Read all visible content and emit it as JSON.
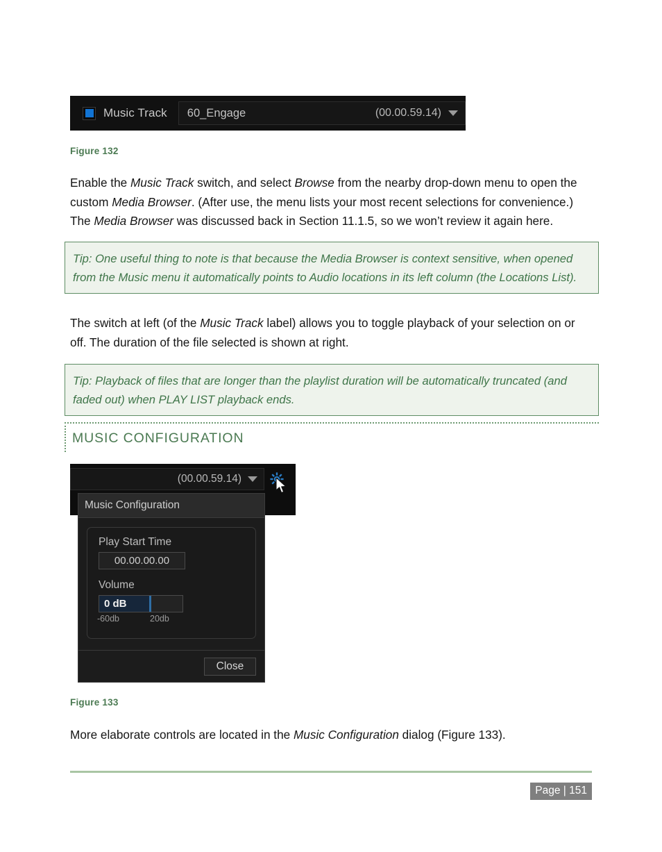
{
  "figure132": {
    "checkbox_state": "checked",
    "accent_color": "#1274d4",
    "label": "Music Track",
    "file_name": "60_Engage",
    "duration": "(00.00.59.14)",
    "dropdown_icon": "chevron-down-icon",
    "caption": "Figure 132"
  },
  "paragraphs": {
    "p1": {
      "seg1": "Enable the ",
      "em1": "Music Track",
      "seg2": " switch, and select ",
      "em2": "Browse",
      "seg3": " from the nearby drop-down menu to open the custom ",
      "em3": "Media Browser",
      "seg4": ".  (After use, the menu lists your most recent selections for convenience.)  The ",
      "em4": "Media Browser",
      "seg5": " was discussed back in Section 11.1.5, so we won’t review it again here."
    },
    "p2": {
      "seg1": "The switch at left (of the ",
      "em1": "Music Track",
      "seg2": " label) allows you to toggle playback of your selection on or off.  The duration of the file selected is shown at right."
    },
    "p3": {
      "seg1": "More elaborate controls are located in the ",
      "em1": "Music Configuration",
      "seg2": " dialog (Figure 133)."
    }
  },
  "tips": {
    "tip1": "Tip: One useful thing to note is that because the Media Browser is context sensitive, when opened from the Music menu it automatically points to Audio locations in its left column (the Locations List).",
    "tip2": "Tip: Playback of files that are longer than the playlist duration will be automatically truncated (and faded out) when PLAY LIST playback ends."
  },
  "section": {
    "heading": "MUSIC CONFIGURATION",
    "heading_color": "#4b7a52"
  },
  "figure133": {
    "strip_duration": "(00.00.59.14)",
    "strip_dropdown_icon": "chevron-down-icon",
    "gear_icon": "gear-icon",
    "gear_color": "#2a7fc9",
    "cursor_icon": "mouse-pointer-icon",
    "dialog_title": "Music Configuration",
    "play_start_time_label": "Play Start Time",
    "play_start_time_value": "00.00.00.00",
    "volume_label": "Volume",
    "volume_value": "0 dB",
    "volume_min": "-60db",
    "volume_max": "20db",
    "volume_fill_percent": 59,
    "close_label": "Close",
    "caption": "Figure 133"
  },
  "footer": {
    "page_label": "Page  |  151"
  }
}
